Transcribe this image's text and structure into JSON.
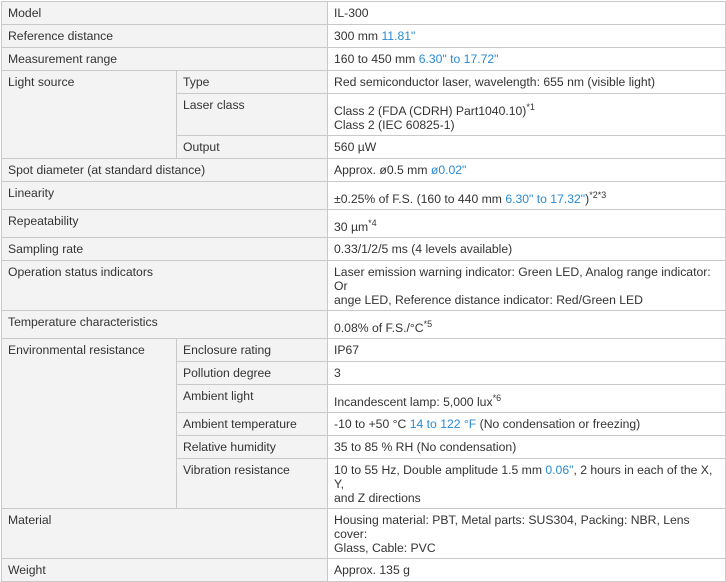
{
  "colors": {
    "accent": "#2a8ad4",
    "label_bg": "#f3f3f3",
    "border": "#c9c9c9",
    "text": "#333333"
  },
  "spec_table": {
    "model": {
      "label": "Model",
      "value": "IL-300"
    },
    "reference_distance": {
      "label": "Reference distance",
      "value": "300 mm",
      "value_in": "11.81\""
    },
    "measurement_range": {
      "label": "Measurement range",
      "value": "160 to 450 mm",
      "value_in": "6.30\" to 17.72\""
    },
    "light_source": {
      "label": "Light source",
      "type": {
        "label": "Type",
        "value": "Red semiconductor laser, wavelength: 655 nm (visible light)"
      },
      "laser_class": {
        "label": "Laser class",
        "line1": "Class 2 (FDA (CDRH) Part1040.10)",
        "line1_note": "*1",
        "line2": "Class 2 (IEC 60825-1)"
      },
      "output": {
        "label": "Output",
        "value": "560 µW"
      }
    },
    "spot_diameter": {
      "label": "Spot diameter (at standard distance)",
      "value": "Approx. ø0.5 mm",
      "value_in": "ø0.02\""
    },
    "linearity": {
      "label": "Linearity",
      "value_pre": "±0.25% of F.S. (160 to 440 mm",
      "value_in": "6.30\" to 17.32\"",
      "value_post": ")",
      "note": "*2*3"
    },
    "repeatability": {
      "label": "Repeatability",
      "value": "30 µm",
      "note": "*4"
    },
    "sampling_rate": {
      "label": "Sampling rate",
      "value": "0.33/1/2/5 ms (4 levels available)"
    },
    "operation_status": {
      "label": "Operation status indicators",
      "line1": "Laser emission warning indicator: Green LED, Analog range indicator: Or",
      "line2": "ange LED, Reference distance indicator: Red/Green LED"
    },
    "temperature": {
      "label": "Temperature characteristics",
      "value": "0.08% of F.S./°C",
      "note": "*5"
    },
    "environmental_resistance": {
      "label": "Environmental resistance",
      "enclosure": {
        "label": "Enclosure rating",
        "value": "IP67"
      },
      "pollution": {
        "label": "Pollution degree",
        "value": "3"
      },
      "ambient_light": {
        "label": "Ambient light",
        "value": "Incandescent lamp: 5,000 lux",
        "note": "*6"
      },
      "ambient_temp": {
        "label": "Ambient temperature",
        "value_pre": "-10 to +50 °C",
        "value_f": "14 to 122 °F",
        "value_post": "(No condensation or freezing)"
      },
      "humidity": {
        "label": "Relative humidity",
        "value": "35 to 85 % RH (No condensation)"
      },
      "vibration": {
        "label": "Vibration resistance",
        "value_pre": "10 to 55 Hz, Double amplitude 1.5 mm",
        "value_in": "0.06\"",
        "value_post": ", 2 hours in each of the X, Y,",
        "line2": "and Z directions"
      }
    },
    "material": {
      "label": "Material",
      "line1": "Housing material: PBT, Metal parts: SUS304, Packing: NBR, Lens cover:",
      "line2": "Glass, Cable: PVC"
    },
    "weight": {
      "label": "Weight",
      "value": "Approx. 135 g"
    }
  }
}
